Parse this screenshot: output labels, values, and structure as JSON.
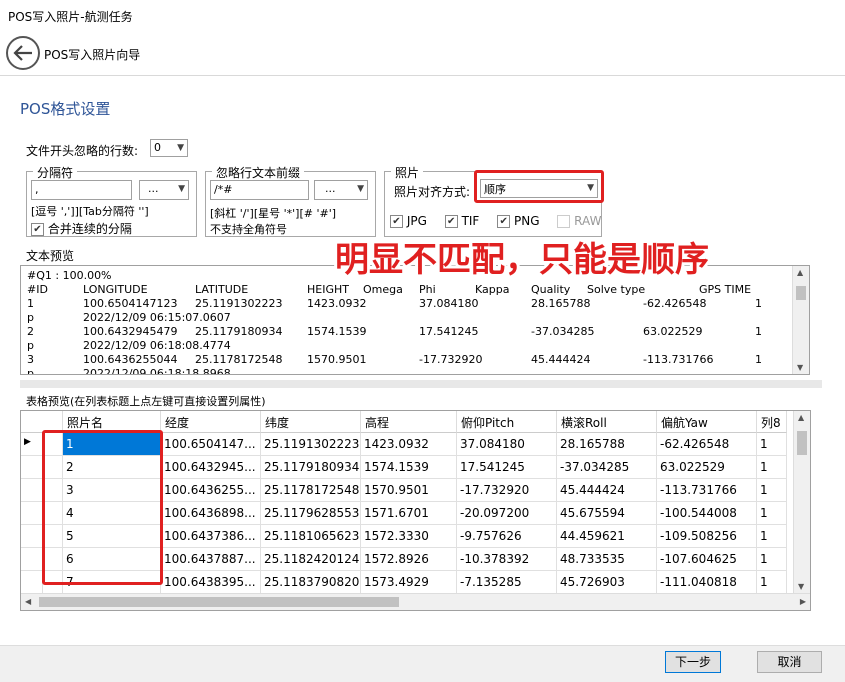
{
  "window": {
    "title": "POS写入照片-航测任务"
  },
  "header": {
    "title": "POS写入照片向导"
  },
  "section": {
    "title": "POS格式设置"
  },
  "skip_lines": {
    "label": "文件开头忽略的行数:",
    "value": "0"
  },
  "separator": {
    "legend": "分隔符",
    "input_value": ",",
    "button": "...",
    "hint": "[逗号 ',']][Tab分隔符 '']",
    "merge_label": "合并连续的分隔"
  },
  "ignore_prefix": {
    "legend": "忽略行文本前缀",
    "input_value": "/*#",
    "button": "...",
    "hint": "[斜杠 '/'][星号 '*'][# '#']",
    "note": "不支持全角符号"
  },
  "photo": {
    "legend": "照片",
    "align_label": "照片对齐方式:",
    "align_value": "顺序",
    "formats": [
      {
        "label": "JPG",
        "checked": true,
        "enabled": true
      },
      {
        "label": "TIF",
        "checked": true,
        "enabled": true
      },
      {
        "label": "PNG",
        "checked": true,
        "enabled": true
      },
      {
        "label": "RAW",
        "checked": false,
        "enabled": false
      }
    ]
  },
  "annotation": {
    "text": "明显不匹配，只能是顺序"
  },
  "text_preview": {
    "label": "文本预览",
    "lines": [
      [
        "#Q1 : 100.00%"
      ],
      [
        "#ID",
        "LONGITUDE",
        "LATITUDE",
        "HEIGHT",
        "Omega",
        "Phi",
        "Kappa",
        "Quality",
        "Solve type",
        "GPS TIME"
      ],
      [
        "1",
        "100.6504147123",
        "25.1191302223",
        "1423.0932",
        "",
        "37.084180",
        "",
        "28.165788",
        "",
        "-62.426548",
        "1"
      ],
      [
        "p",
        "2022/12/09 06:15:07.0607"
      ],
      [
        "2",
        "100.6432945479",
        "25.1179180934",
        "1574.1539",
        "",
        "17.541245",
        "",
        "-37.034285",
        "",
        "63.022529",
        "1"
      ],
      [
        "p",
        "2022/12/09 06:18:08.4774"
      ],
      [
        "3",
        "100.6436255044",
        "25.1178172548",
        "1570.9501",
        "",
        "-17.732920",
        "",
        "45.444424",
        "",
        "-113.731766",
        "1"
      ],
      [
        "p",
        "2022/12/09 06:18:18.8968"
      ]
    ]
  },
  "table_preview": {
    "label": "表格预览(在列表标题上点左键可直接设置列属性)",
    "columns": [
      "照片名",
      "经度",
      "纬度",
      "高程",
      "俯仰Pitch",
      "横滚Roll",
      "偏航Yaw",
      "列8"
    ],
    "rows": [
      [
        "1",
        "100.6504147...",
        "25.1191302223",
        "1423.0932",
        "37.084180",
        "28.165788",
        "-62.426548",
        "1"
      ],
      [
        "2",
        "100.6432945...",
        "25.1179180934",
        "1574.1539",
        "17.541245",
        "-37.034285",
        "63.022529",
        "1"
      ],
      [
        "3",
        "100.6436255...",
        "25.1178172548",
        "1570.9501",
        "-17.732920",
        "45.444424",
        "-113.731766",
        "1"
      ],
      [
        "4",
        "100.6436898...",
        "25.1179628553",
        "1571.6701",
        "-20.097200",
        "45.675594",
        "-100.544008",
        "1"
      ],
      [
        "5",
        "100.6437386...",
        "25.1181065623",
        "1572.3330",
        "-9.757626",
        "44.459621",
        "-109.508256",
        "1"
      ],
      [
        "6",
        "100.6437887...",
        "25.1182420124",
        "1572.8926",
        "-10.378392",
        "48.733535",
        "-107.604625",
        "1"
      ],
      [
        "7",
        "100.6438395...",
        "25.1183790820",
        "1573.4929",
        "-7.135285",
        "45.726903",
        "-111.040818",
        "1"
      ]
    ]
  },
  "footer": {
    "next": "下一步",
    "cancel": "取消"
  }
}
